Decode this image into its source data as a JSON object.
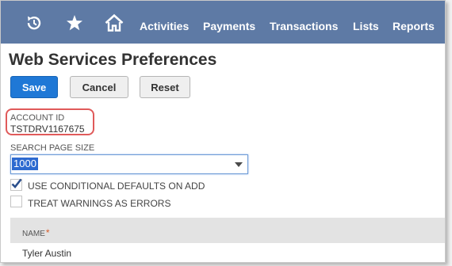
{
  "nav": {
    "icons": [
      "recent-icon",
      "star-icon",
      "home-icon"
    ],
    "items": [
      "Activities",
      "Payments",
      "Transactions",
      "Lists",
      "Reports"
    ]
  },
  "page": {
    "title": "Web Services Preferences"
  },
  "buttons": {
    "save": "Save",
    "cancel": "Cancel",
    "reset": "Reset"
  },
  "account": {
    "label": "ACCOUNT ID",
    "value": "TSTDRV1167675"
  },
  "search_page_size": {
    "label": "SEARCH PAGE SIZE",
    "value": "1000"
  },
  "options": [
    {
      "label": "USE CONDITIONAL DEFAULTS ON ADD",
      "checked": true
    },
    {
      "label": "TREAT WARNINGS AS ERRORS",
      "checked": false
    }
  ],
  "table": {
    "header": "NAME",
    "required_marker": "*",
    "rows": [
      "Tyler Austin"
    ]
  },
  "colors": {
    "nav_bg": "#5e7aa5",
    "primary": "#1f78d6",
    "highlight": "#e05a5a"
  }
}
